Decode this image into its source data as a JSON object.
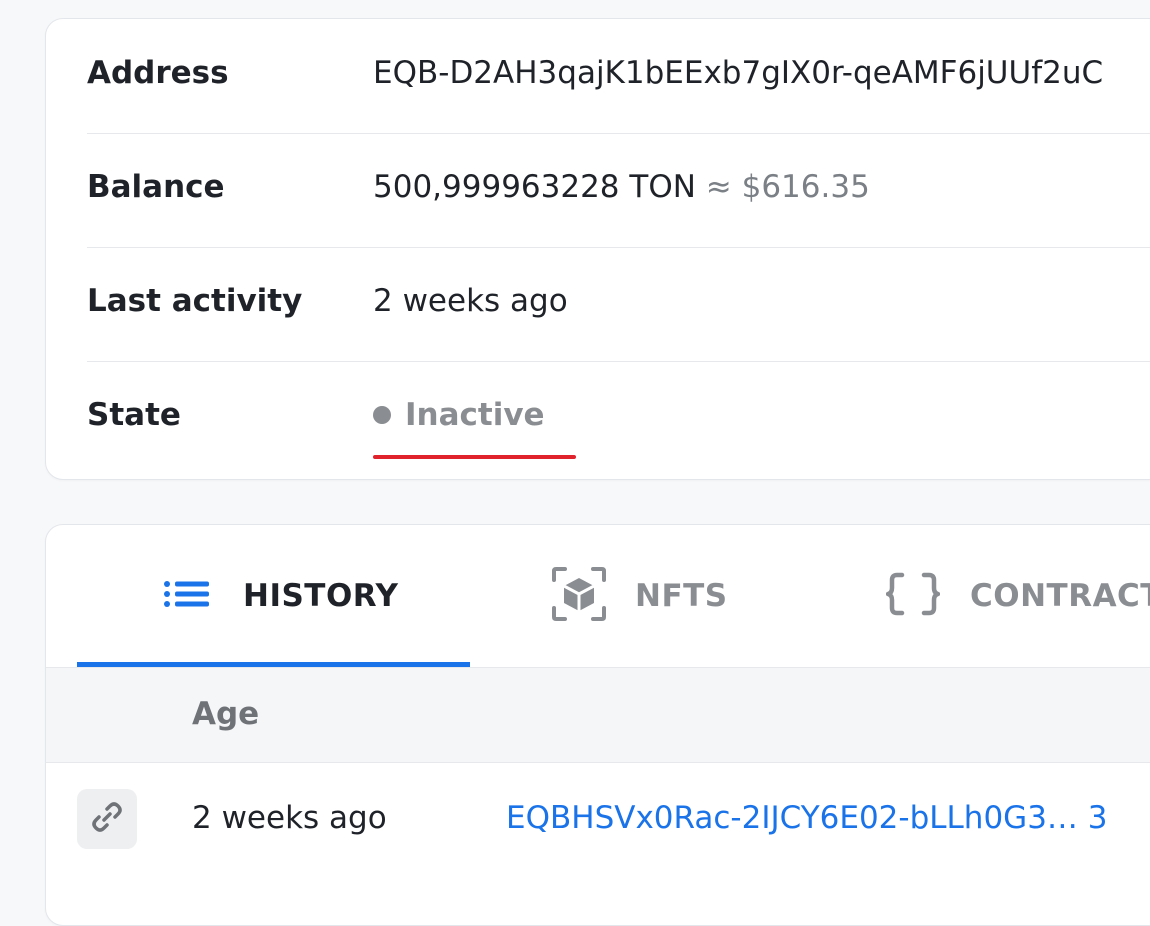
{
  "account": {
    "address_label": "Address",
    "address_value": "EQB-D2AH3qajK1bEExb7gIX0r-qeAMF6jUUf2uC",
    "balance_label": "Balance",
    "balance_ton": "500,999963228 TON",
    "balance_fiat": "≈ $616.35",
    "last_activity_label": "Last activity",
    "last_activity_value": "2 weeks ago",
    "state_label": "State",
    "state_value": "Inactive"
  },
  "tabs": [
    {
      "label": "HISTORY",
      "icon": "list-icon",
      "active": true
    },
    {
      "label": "NFTS",
      "icon": "cube-icon",
      "active": false
    },
    {
      "label": "CONTRACT",
      "icon": "braces-icon",
      "active": false
    }
  ],
  "history": {
    "columns": [
      "Age"
    ],
    "rows": [
      {
        "age": "2 weeks ago",
        "address": "EQBHSVx0Rac-2IJCY6E02-bLLh0G3… 3"
      }
    ]
  },
  "colors": {
    "accent": "#1a73e8",
    "annotation_underline": "#e0222d",
    "inactive": "#8a8d91"
  }
}
